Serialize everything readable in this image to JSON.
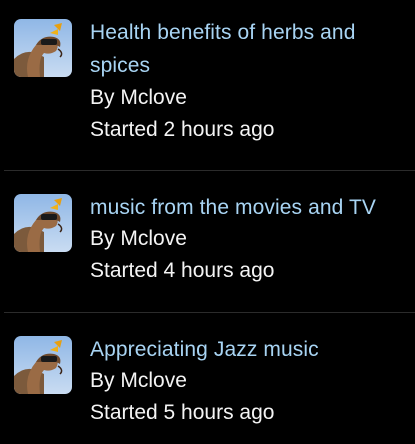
{
  "topics": [
    {
      "title": "Health benefits of herbs and spices",
      "by_label": "By",
      "author": "Mclove",
      "started": "Started 2 hours ago"
    },
    {
      "title": "music from the movies and TV",
      "by_label": "By",
      "author": "Mclove",
      "started": "Started 4 hours ago"
    },
    {
      "title": "Appreciating Jazz music",
      "by_label": "By",
      "author": "Mclove",
      "started": "Started 5 hours ago"
    }
  ],
  "colors": {
    "background": "#000000",
    "title_link": "#a8d4f3",
    "text": "#f4f4f4",
    "divider": "#2b2b2b"
  }
}
